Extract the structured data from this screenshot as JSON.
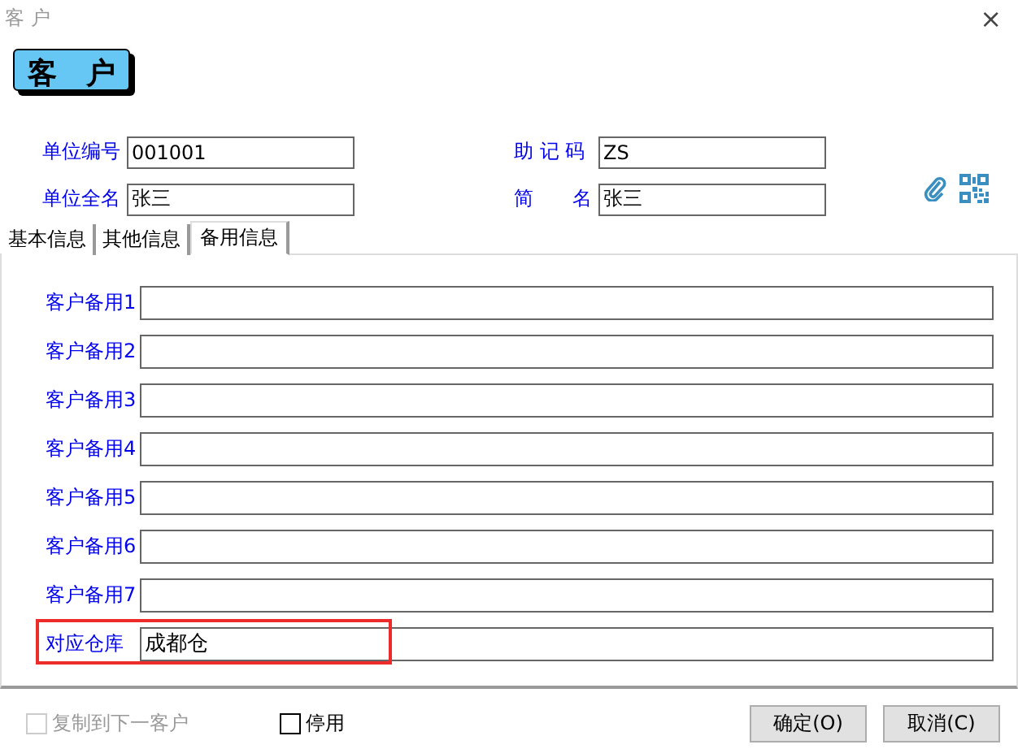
{
  "window": {
    "title": "客 户",
    "close": "×"
  },
  "header_button": "客　户",
  "fields": [
    {
      "label": "单位编号",
      "value": "001001"
    },
    {
      "label": "助 记 码",
      "value": "ZS"
    },
    {
      "label": "单位全名",
      "value": "张三"
    },
    {
      "label": "简　　名",
      "value": "张三"
    }
  ],
  "tabs": [
    {
      "label": "基本信息",
      "selected": false
    },
    {
      "label": "其他信息",
      "selected": false
    },
    {
      "label": "备用信息",
      "selected": true
    }
  ],
  "rows": [
    {
      "label": "客户备用1",
      "value": "",
      "highlighted": false
    },
    {
      "label": "客户备用2",
      "value": "",
      "highlighted": false
    },
    {
      "label": "客户备用3",
      "value": "",
      "highlighted": false
    },
    {
      "label": "客户备用4",
      "value": "",
      "highlighted": false
    },
    {
      "label": "客户备用5",
      "value": "",
      "highlighted": false
    },
    {
      "label": "客户备用6",
      "value": "",
      "highlighted": false
    },
    {
      "label": "客户备用7",
      "value": "",
      "highlighted": false
    },
    {
      "label": "对应仓库",
      "value": "成都仓",
      "highlighted": true
    }
  ],
  "options": [
    {
      "label": "复制到下一客户",
      "checked": false,
      "disabled": true
    },
    {
      "label": "停用",
      "checked": false,
      "disabled": false
    }
  ],
  "buttons": [
    "确定(O)",
    "取消(C)"
  ]
}
